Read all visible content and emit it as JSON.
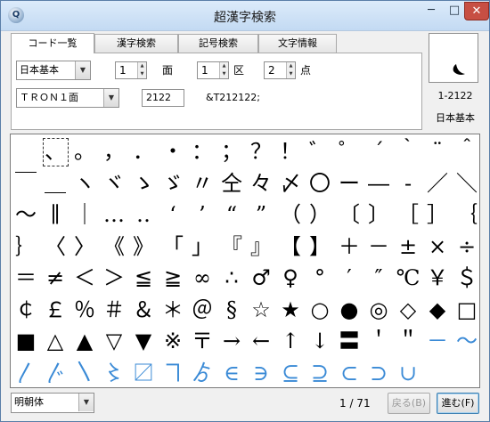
{
  "window": {
    "title": "超漢字検索",
    "app_icon": "globe-magnifier-icon",
    "min_glyph": "─",
    "max_glyph": "□",
    "close_glyph": "✕"
  },
  "tabs": [
    {
      "label": "コード一覧"
    },
    {
      "label": "漢字検索"
    },
    {
      "label": "記号検索"
    },
    {
      "label": "文字情報"
    }
  ],
  "code_panel": {
    "set_select": "日本基本",
    "face_value": "1",
    "face_label": "面",
    "ku_value": "1",
    "ku_label": "区",
    "ten_value": "2",
    "ten_label": "点",
    "tron_select": "ＴＲＯＮ１面",
    "code_value": "2122",
    "entity_text": "&T212122;"
  },
  "preview": {
    "code": "1-2122",
    "set_name": "日本基本"
  },
  "glyphs": [
    "　",
    "、",
    "。",
    "，",
    "．",
    "・",
    "：",
    "；",
    "？",
    "！",
    "゛",
    "゜",
    "´",
    "｀",
    "¨",
    "＾",
    "￣",
    "＿",
    "ヽ",
    "ヾ",
    "ゝ",
    "ゞ",
    "〃",
    "仝",
    "々",
    "〆",
    "〇",
    "ー",
    "―",
    "‐",
    "／",
    "＼",
    "～",
    "∥",
    "｜",
    "…",
    "‥",
    "‘",
    "’",
    "“",
    "”",
    "（",
    "）",
    "〔",
    "〕",
    "［",
    "］",
    "｛",
    "｝",
    "〈",
    "〉",
    "《",
    "》",
    "「",
    "」",
    "『",
    "』",
    "【",
    "】",
    "＋",
    "－",
    "±",
    "×",
    "÷",
    "＝",
    "≠",
    "＜",
    "＞",
    "≦",
    "≧",
    "∞",
    "∴",
    "♂",
    "♀",
    "°",
    "′",
    "″",
    "℃",
    "￥",
    "＄",
    "￠",
    "￡",
    "％",
    "＃",
    "＆",
    "＊",
    "＠",
    "§",
    "☆",
    "★",
    "○",
    "●",
    "◎",
    "◇",
    "◆",
    "□",
    "■",
    "△",
    "▲",
    "▽",
    "▼",
    "※",
    "〒",
    "→",
    "←",
    "↑",
    "↓",
    "〓",
    "＇",
    "＂",
    "－",
    "～",
    "〳",
    "〴",
    "〵",
    "〻",
    "〼",
    "ヿ",
    "ゟ",
    "∈",
    "∋",
    "⊆",
    "⊇",
    "⊂",
    "⊃",
    "∪"
  ],
  "blue_from_index": 110,
  "status": {
    "font_select": "明朝体",
    "page_info": "1 / 71",
    "prev_button": "戻る(B)",
    "next_button": "進む(F)"
  },
  "colors": {
    "accent_blue": "#3a8ad6",
    "close_red": "#c74f43"
  }
}
